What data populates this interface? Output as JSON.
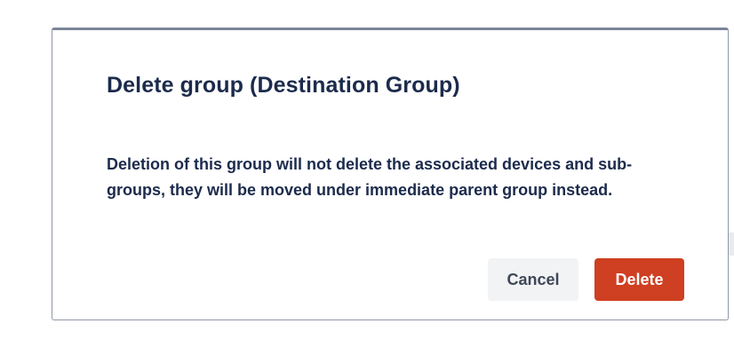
{
  "dialog": {
    "title": "Delete group (Destination Group)",
    "message": "Deletion of this group will not delete the associated devices and sub-groups, they will be moved under immediate parent group instead.",
    "cancel_label": "Cancel",
    "delete_label": "Delete"
  },
  "colors": {
    "danger": "#cf3f21",
    "text": "#1c2b4c",
    "secondary_button": "#f2f3f5"
  }
}
